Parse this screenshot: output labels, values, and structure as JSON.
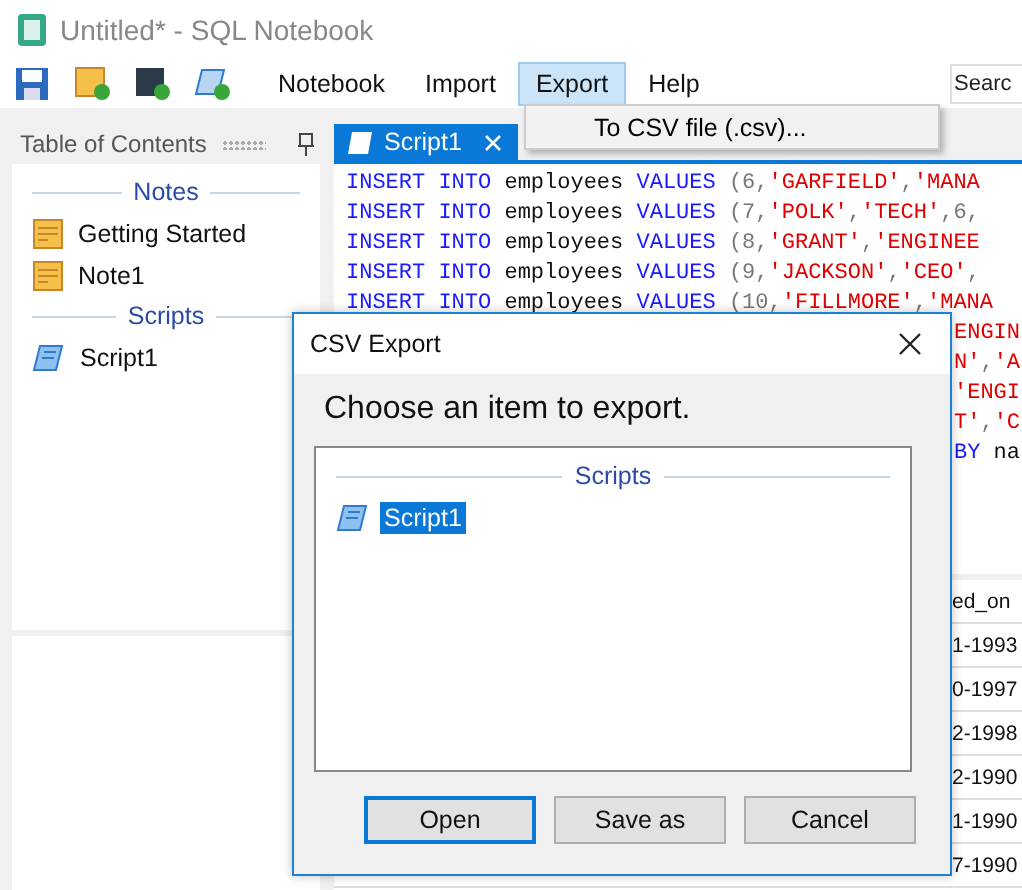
{
  "window": {
    "title": "Untitled* - SQL Notebook"
  },
  "menu": [
    {
      "label": "Notebook",
      "selected": false
    },
    {
      "label": "Import",
      "selected": false
    },
    {
      "label": "Export",
      "selected": true
    },
    {
      "label": "Help",
      "selected": false
    }
  ],
  "search": {
    "placeholder": "Searc"
  },
  "export_menu": {
    "items": [
      "To CSV file (.csv)..."
    ]
  },
  "sidebar": {
    "title": "Table of Contents",
    "sections": [
      {
        "title": "Notes",
        "items": [
          {
            "label": "Getting Started",
            "kind": "note"
          },
          {
            "label": "Note1",
            "kind": "note"
          }
        ]
      },
      {
        "title": "Scripts",
        "items": [
          {
            "label": "Script1",
            "kind": "script"
          }
        ]
      }
    ]
  },
  "editor": {
    "tabs": [
      {
        "label": "Script1",
        "selected": true
      }
    ],
    "lines": [
      {
        "kind": "full",
        "segments": [
          {
            "kind": "keyword",
            "text": "INSERT INTO"
          },
          {
            "kind": "plain",
            "text": " employees "
          },
          {
            "kind": "keyword",
            "text": "VALUES"
          },
          {
            "kind": "punct",
            "text": " (6,"
          },
          {
            "kind": "string",
            "text": "'GARFIELD'"
          },
          {
            "kind": "punct",
            "text": ","
          },
          {
            "kind": "string",
            "text": "'MANA"
          }
        ]
      },
      {
        "kind": "full",
        "segments": [
          {
            "kind": "keyword",
            "text": "INSERT INTO"
          },
          {
            "kind": "plain",
            "text": " employees "
          },
          {
            "kind": "keyword",
            "text": "VALUES"
          },
          {
            "kind": "punct",
            "text": " (7,"
          },
          {
            "kind": "string",
            "text": "'POLK'"
          },
          {
            "kind": "punct",
            "text": ","
          },
          {
            "kind": "string",
            "text": "'TECH'"
          },
          {
            "kind": "punct",
            "text": ",6,"
          }
        ]
      },
      {
        "kind": "full",
        "segments": [
          {
            "kind": "keyword",
            "text": "INSERT INTO"
          },
          {
            "kind": "plain",
            "text": " employees "
          },
          {
            "kind": "keyword",
            "text": "VALUES"
          },
          {
            "kind": "punct",
            "text": " (8,"
          },
          {
            "kind": "string",
            "text": "'GRANT'"
          },
          {
            "kind": "punct",
            "text": ","
          },
          {
            "kind": "string",
            "text": "'ENGINEE"
          }
        ]
      },
      {
        "kind": "full",
        "segments": [
          {
            "kind": "keyword",
            "text": "INSERT INTO"
          },
          {
            "kind": "plain",
            "text": " employees "
          },
          {
            "kind": "keyword",
            "text": "VALUES"
          },
          {
            "kind": "punct",
            "text": " (9,"
          },
          {
            "kind": "string",
            "text": "'JACKSON'"
          },
          {
            "kind": "punct",
            "text": ","
          },
          {
            "kind": "string",
            "text": "'CEO'"
          },
          {
            "kind": "punct",
            "text": ","
          }
        ]
      },
      {
        "kind": "full",
        "segments": [
          {
            "kind": "keyword",
            "text": "INSERT INTO"
          },
          {
            "kind": "plain",
            "text": " employees "
          },
          {
            "kind": "keyword",
            "text": "VALUES"
          },
          {
            "kind": "punct",
            "text": " (10,"
          },
          {
            "kind": "string",
            "text": "'FILLMORE'"
          },
          {
            "kind": "punct",
            "text": ","
          },
          {
            "kind": "string",
            "text": "'MANA"
          }
        ]
      },
      {
        "kind": "tail",
        "segments": [
          {
            "kind": "string",
            "text": "ENGIN"
          }
        ]
      },
      {
        "kind": "tail",
        "segments": [
          {
            "kind": "string",
            "text": "N'"
          },
          {
            "kind": "punct",
            "text": ","
          },
          {
            "kind": "string",
            "text": "'A"
          }
        ]
      },
      {
        "kind": "tail",
        "segments": [
          {
            "kind": "string",
            "text": "'ENGI"
          }
        ]
      },
      {
        "kind": "tail",
        "segments": [
          {
            "kind": "string",
            "text": "T'"
          },
          {
            "kind": "punct",
            "text": ","
          },
          {
            "kind": "string",
            "text": "'C"
          }
        ]
      },
      {
        "kind": "tail",
        "segments": [
          {
            "kind": "keyword",
            "text": "BY"
          },
          {
            "kind": "plain",
            "text": " na"
          }
        ]
      }
    ]
  },
  "results": {
    "header": "ed_on",
    "rows": [
      "1-1993",
      "0-1997",
      "2-1998",
      "2-1990",
      "1-1990",
      "7-1990"
    ]
  },
  "dialog": {
    "title": "CSV Export",
    "prompt": "Choose an item to export.",
    "list": {
      "section": "Scripts",
      "items": [
        {
          "label": "Script1",
          "kind": "script",
          "selected": true
        }
      ]
    },
    "buttons": [
      {
        "label": "Open",
        "focused": true
      },
      {
        "label": "Save as",
        "focused": false
      },
      {
        "label": "Cancel",
        "focused": false
      }
    ]
  }
}
